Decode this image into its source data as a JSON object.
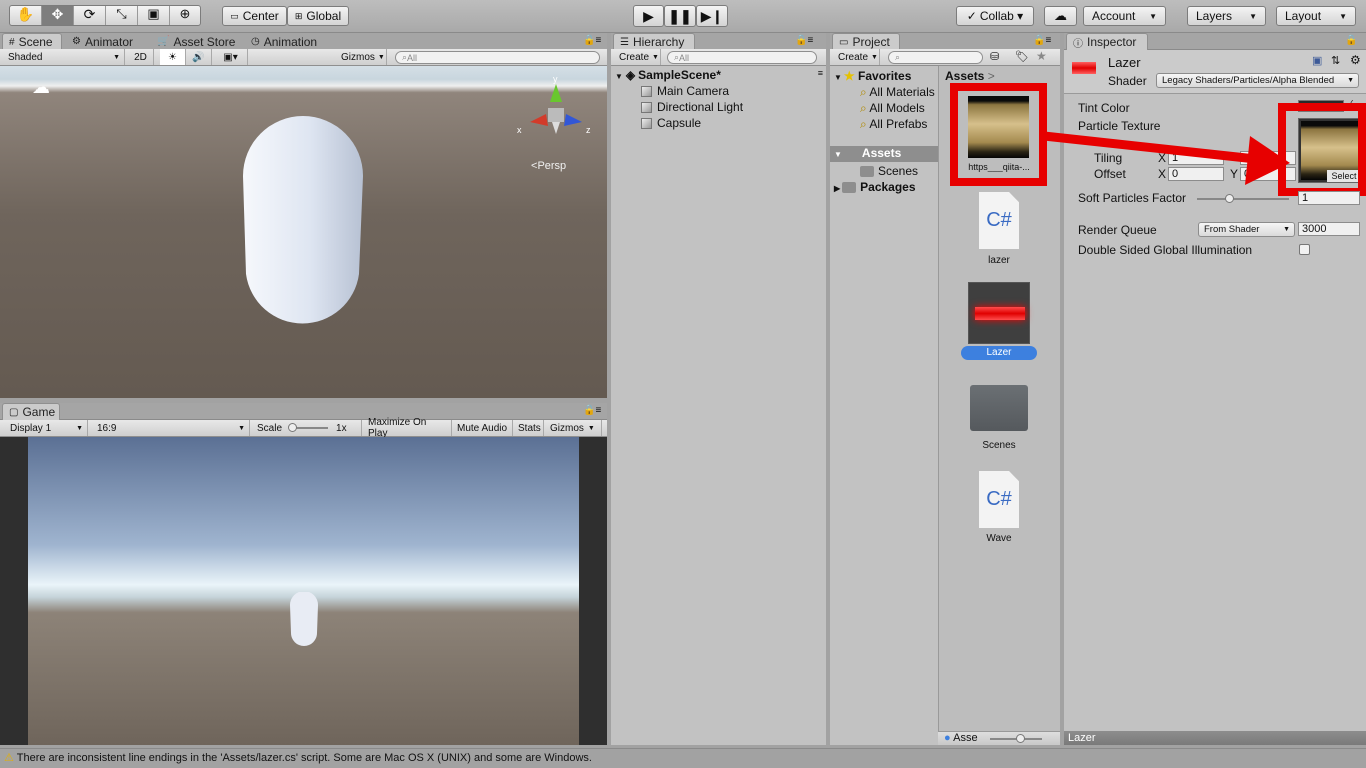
{
  "toolbar": {
    "pivot": "Center",
    "space": "Global",
    "collab": "Collab ▾",
    "account": "Account",
    "layers": "Layers",
    "layout": "Layout"
  },
  "scene": {
    "tabs": [
      "Scene",
      "Animator",
      "Asset Store",
      "Animation"
    ],
    "shading": "Shaded",
    "mode2d": "2D",
    "gizmos": "Gizmos",
    "search_placeholder": "All",
    "persp": "Persp",
    "axis_x": "x",
    "axis_y": "y",
    "axis_z": "z"
  },
  "game": {
    "tab": "Game",
    "display": "Display 1",
    "aspect": "16:9",
    "scale_label": "Scale",
    "scale_value": "1x",
    "buttons": [
      "Maximize On Play",
      "Mute Audio",
      "Stats",
      "Gizmos"
    ]
  },
  "hierarchy": {
    "tab": "Hierarchy",
    "create": "Create",
    "search_placeholder": "All",
    "scene": "SampleScene*",
    "items": [
      "Main Camera",
      "Directional Light",
      "Capsule"
    ]
  },
  "project": {
    "tab": "Project",
    "create": "Create",
    "favorites": "Favorites",
    "fav_items": [
      "All Materials",
      "All Models",
      "All Prefabs"
    ],
    "assets_root": "Assets",
    "assets_children": [
      "Scenes"
    ],
    "packages": "Packages",
    "breadcrumb": "Assets",
    "breadcrumb_sep": ">",
    "asset_items": [
      "https___qiita-...",
      "lazer",
      "Lazer",
      "Scenes",
      "Wave"
    ],
    "csharp": "C#",
    "bottom_label": "Asse"
  },
  "inspector": {
    "tab": "Inspector",
    "name": "Lazer",
    "shader_label": "Shader",
    "shader_value": "Legacy Shaders/Particles/Alpha Blended",
    "tint_color": "Tint Color",
    "particle_texture": "Particle Texture",
    "tiling": "Tiling",
    "offset": "Offset",
    "x": "X",
    "y": "Y",
    "tiling_x": "1",
    "offset_x": "0",
    "offset_y": "0",
    "select": "Select",
    "soft_particles": "Soft Particles Factor",
    "soft_value": "1",
    "render_queue": "Render Queue",
    "render_queue_mode": "From Shader",
    "render_queue_value": "3000",
    "double_sided": "Double Sided Global Illumination",
    "footer": "Lazer"
  },
  "status": {
    "message": "There are inconsistent line endings in the 'Assets/lazer.cs' script. Some are Mac OS X (UNIX) and some are Windows."
  },
  "colors": {
    "highlight": "#e70000",
    "selection": "#3d80df"
  }
}
